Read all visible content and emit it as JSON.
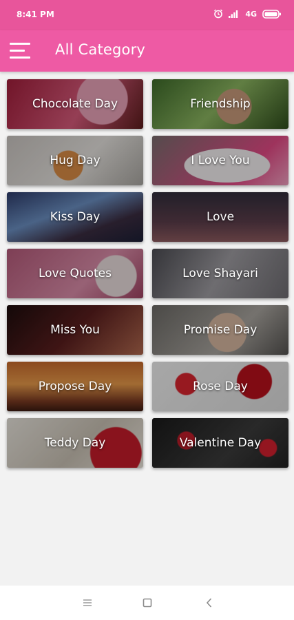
{
  "status_bar": {
    "time": "8:41 PM",
    "network": "4G"
  },
  "app_bar": {
    "title": "All Category"
  },
  "categories": [
    {
      "label": "Chocolate Day"
    },
    {
      "label": "Friendship"
    },
    {
      "label": "Hug Day"
    },
    {
      "label": "I Love You"
    },
    {
      "label": "Kiss Day"
    },
    {
      "label": "Love"
    },
    {
      "label": "Love Quotes"
    },
    {
      "label": "Love Shayari"
    },
    {
      "label": "Miss You"
    },
    {
      "label": "Promise Day"
    },
    {
      "label": "Propose Day"
    },
    {
      "label": "Rose Day"
    },
    {
      "label": "Teddy Day"
    },
    {
      "label": "Valentine Day"
    }
  ],
  "icons": {
    "menu": "hamburger-menu-icon",
    "alarm": "alarm-icon",
    "signal": "signal-icon",
    "battery": "battery-icon",
    "nav_recents": "recents-icon",
    "nav_home": "home-icon",
    "nav_back": "back-icon"
  },
  "colors": {
    "status_bar": "#e8559b",
    "app_bar": "#ee5aa4",
    "background": "#f2f2f2"
  }
}
